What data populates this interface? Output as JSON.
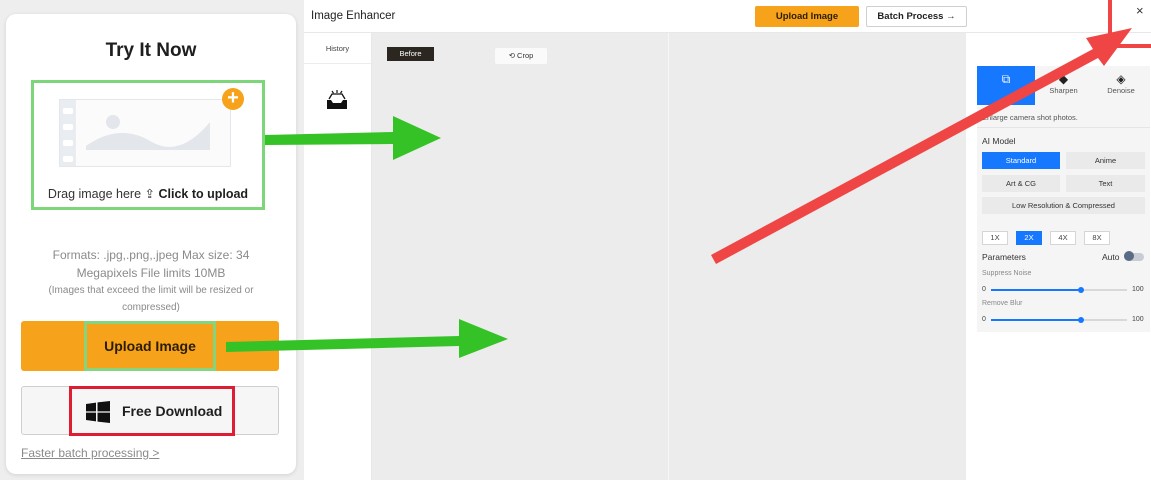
{
  "try_card": {
    "title": "Try It Now",
    "drag_text": "Drag image here",
    "click_upload": "Click to upload",
    "formats_line1": "Formats: .jpg,.png,.jpeg Max size: 34",
    "formats_line2": "Megapixels File limits 10MB",
    "note_line1": "(Images that exceed the limit will be resized or",
    "note_line2": "compressed)",
    "upload_button": "Upload Image",
    "free_download_button": "Free Download",
    "faster_link": "Faster batch processing >"
  },
  "topbar": {
    "title": "Image Enhancer",
    "upload_button": "Upload Image",
    "batch_button": "Batch Process →",
    "close": "×"
  },
  "history": {
    "label": "History"
  },
  "canvas": {
    "before_tag": "Before",
    "crop_button": "⟲ Crop"
  },
  "panel": {
    "tabs": [
      {
        "label": "",
        "icon": "enlarge-icon"
      },
      {
        "label": "Sharpen",
        "icon": "sharpen-icon"
      },
      {
        "label": "Denoise",
        "icon": "denoise-icon"
      }
    ],
    "description": "Enlarge camera shot photos.",
    "ai_model_label": "AI Model",
    "models": {
      "standard": "Standard",
      "anime": "Anime",
      "art_cg": "Art & CG",
      "text": "Text",
      "low_res": "Low Resolution & Compressed"
    },
    "scales": [
      "1X",
      "2X",
      "4X",
      "8X"
    ],
    "selected_scale": "2X",
    "parameters_label": "Parameters",
    "auto_label": "Auto",
    "auto_enabled": false,
    "sliders": [
      {
        "label": "Suppress Noise",
        "min": "0",
        "max": "100",
        "value": 66
      },
      {
        "label": "Remove Blur",
        "min": "0",
        "max": "100",
        "value": 66
      }
    ]
  },
  "colors": {
    "accent_orange": "#f7a21b",
    "accent_blue": "#1677ff",
    "highlight_green": "#7ed67a",
    "highlight_red": "#de1d34",
    "arrow_green": "#35c226",
    "arrow_red": "#ef4545"
  }
}
